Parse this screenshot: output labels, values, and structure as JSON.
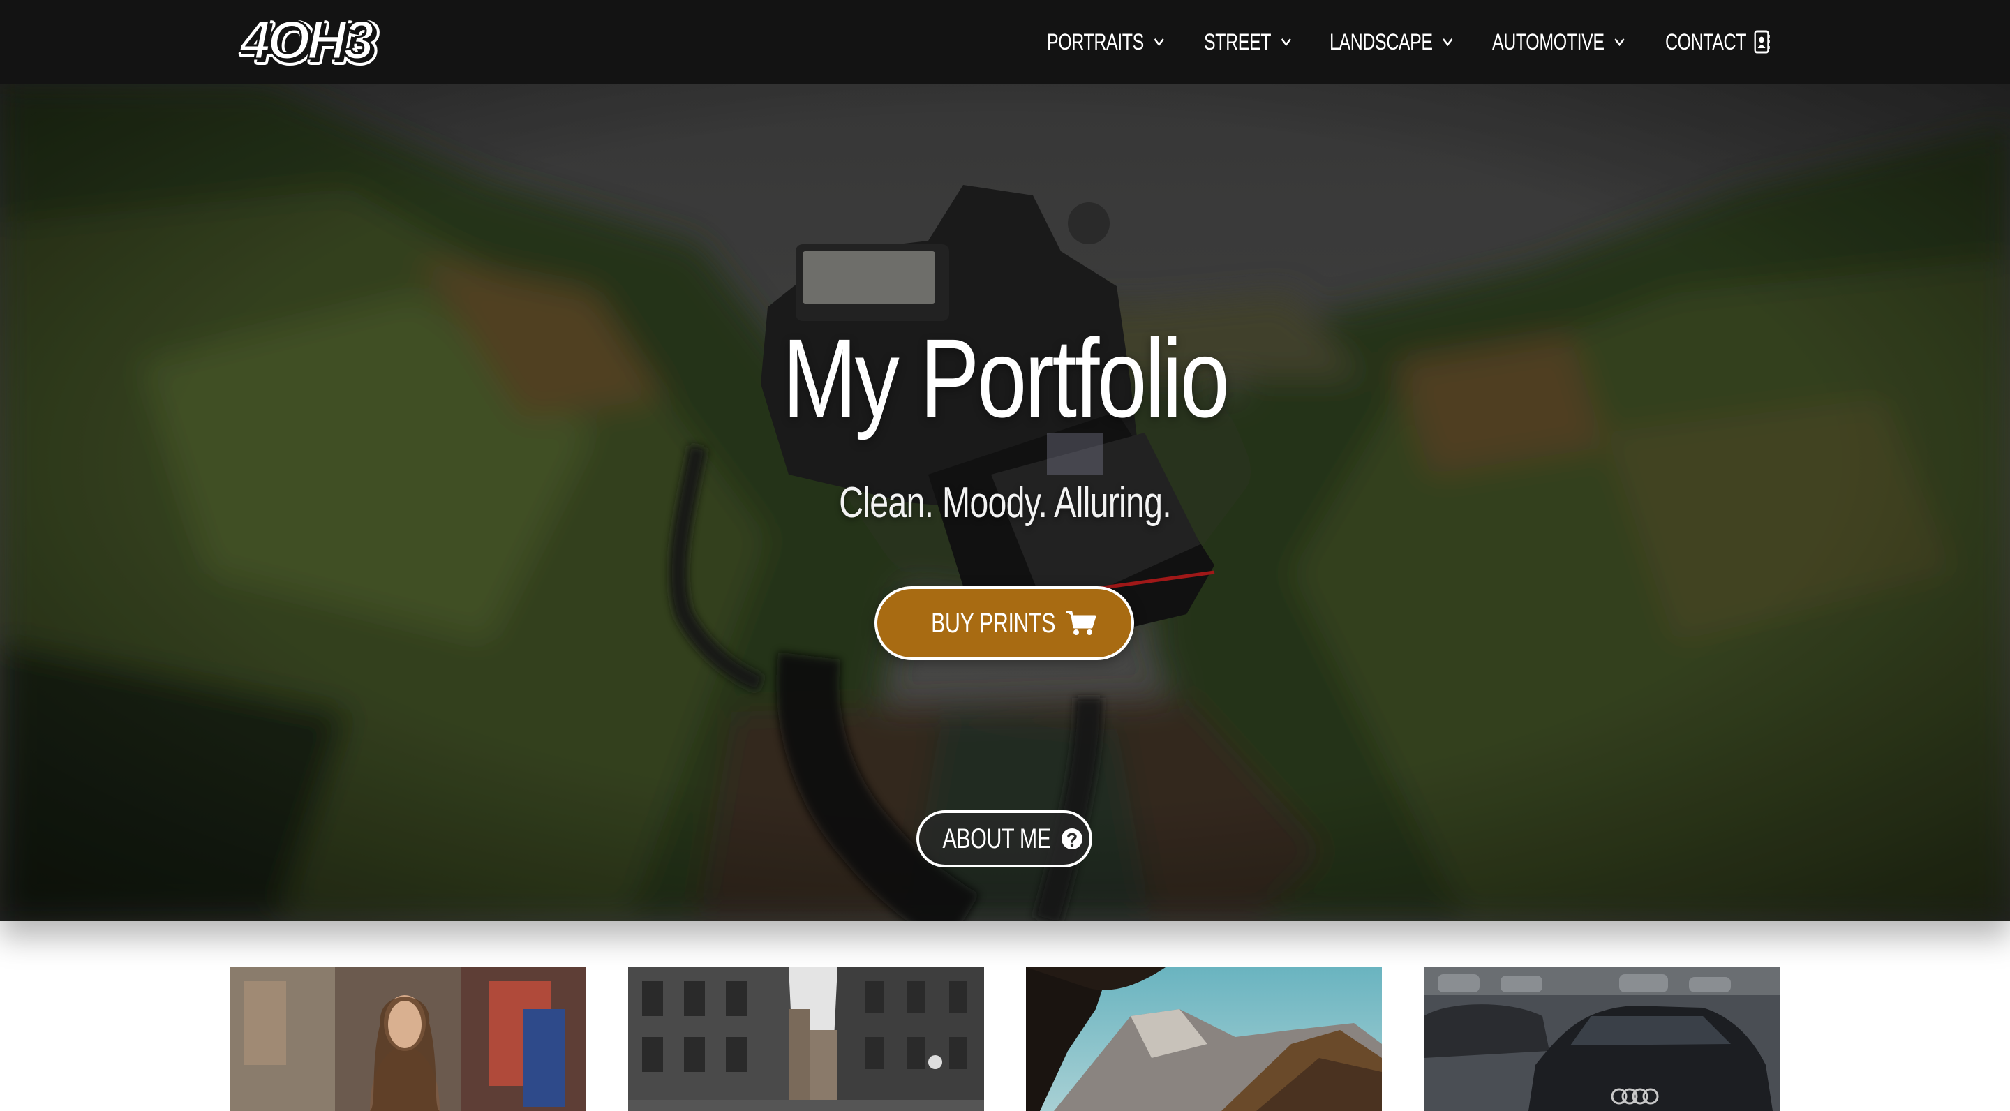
{
  "brand": {
    "logo_text": "4OH3"
  },
  "nav": {
    "portraits": "PORTRAITS",
    "street": "STREET",
    "landscape": "LANDSCAPE",
    "automotive": "AUTOMOTIVE",
    "contact": "CONTACT"
  },
  "hero": {
    "title": "My Portfolio",
    "subtitle": "Clean. Moody. Alluring.",
    "buy_prints_label": "BUY PRINTS",
    "about_label": "ABOUT ME",
    "accent_color": "#a86b12"
  },
  "gallery": {
    "thumbnails": [
      "portrait",
      "street",
      "landscape",
      "automotive"
    ]
  }
}
